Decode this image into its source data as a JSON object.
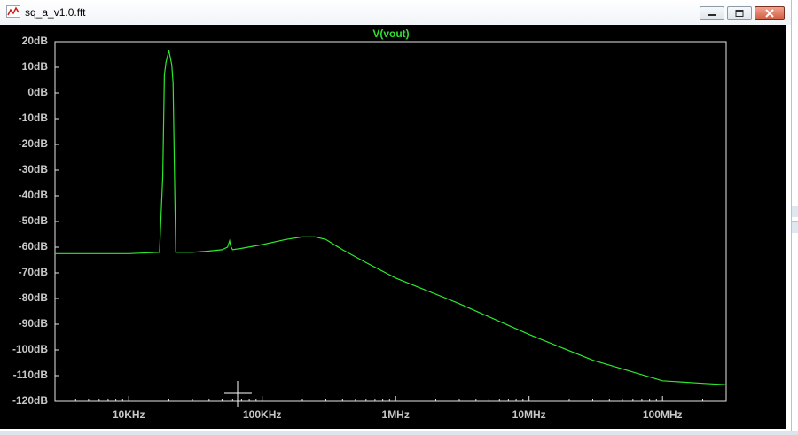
{
  "window": {
    "title": "sq_a_v1.0.fft",
    "icon": "waveform-icon"
  },
  "titlebar_buttons": {
    "minimize_icon": "minimize-icon",
    "maximize_icon": "maximize-icon",
    "close_icon": "close-icon"
  },
  "colors": {
    "trace": "#2ee82e",
    "plot_background": "#000000",
    "frame": "#e6e6e6",
    "tick_text": "#c8c8c8"
  },
  "chart_data": {
    "type": "line",
    "title": "V(vout)",
    "xscale": "log",
    "xlim": [
      2800,
      300000000
    ],
    "ylim": [
      -120,
      20
    ],
    "grid": false,
    "y_ticks": [
      "20dB",
      "10dB",
      "0dB",
      "-10dB",
      "-20dB",
      "-30dB",
      "-40dB",
      "-50dB",
      "-60dB",
      "-70dB",
      "-80dB",
      "-90dB",
      "-100dB",
      "-110dB",
      "-120dB"
    ],
    "x_ticks": [
      "10KHz",
      "100KHz",
      "1MHz",
      "10MHz",
      "100MHz"
    ],
    "series": [
      {
        "name": "V(vout)",
        "x": [
          2800,
          5000,
          10000,
          17000,
          18000,
          18500,
          19000,
          20000,
          21000,
          21500,
          22500,
          23500,
          30000,
          40000,
          50000,
          55000,
          57000,
          58000,
          60000,
          70000,
          100000,
          150000,
          200000,
          250000,
          300000,
          400000,
          600000,
          1000000,
          3000000,
          10000000,
          30000000,
          100000000,
          200000000,
          300000000
        ],
        "y": [
          -62.5,
          -62.5,
          -62.5,
          -62.0,
          -32,
          7,
          12,
          16.5,
          11,
          4,
          -62,
          -62,
          -62,
          -61.5,
          -61,
          -60,
          -57.5,
          -59.5,
          -61,
          -60.5,
          -59,
          -57,
          -56,
          -56,
          -57,
          -61,
          -66,
          -72,
          -82,
          -94,
          -104,
          -112,
          -113,
          -113.5
        ]
      }
    ]
  }
}
